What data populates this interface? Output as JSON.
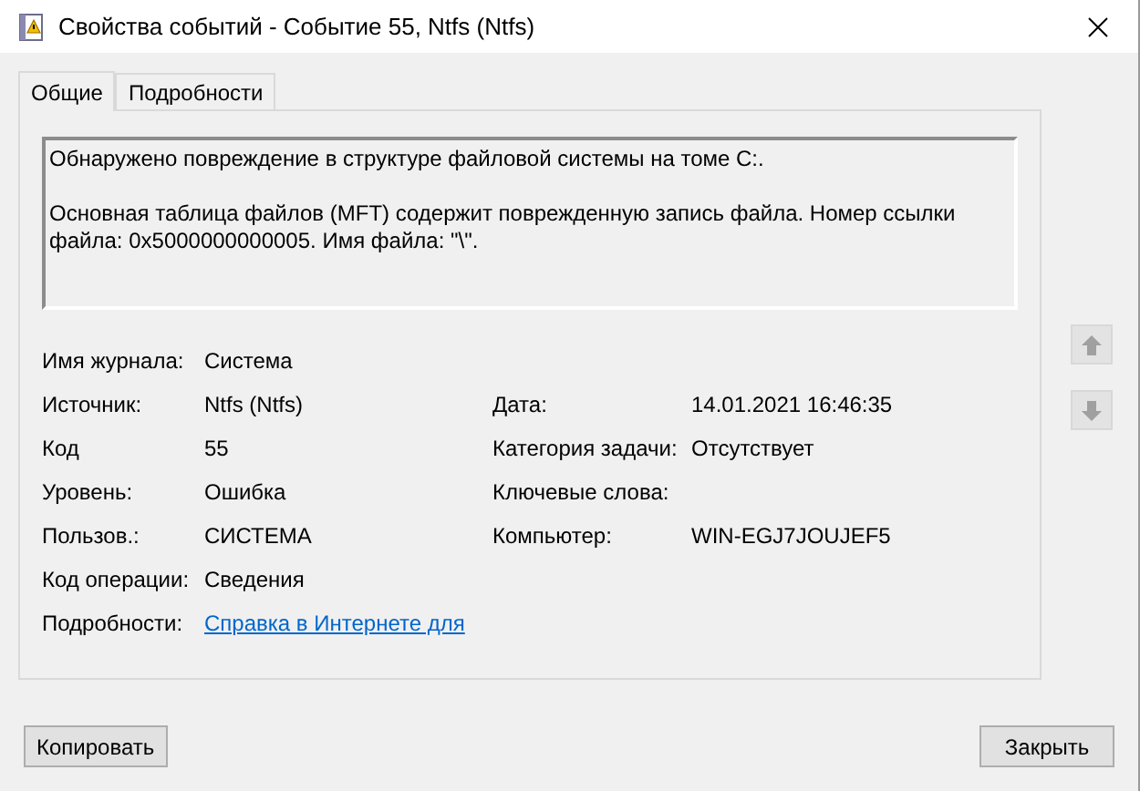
{
  "window": {
    "title": "Свойства событий - Событие 55, Ntfs (Ntfs)"
  },
  "tabs": [
    {
      "label": "Общие",
      "selected": true
    },
    {
      "label": "Подробности",
      "selected": false
    }
  ],
  "message": [
    "Обнаружено повреждение в структуре файловой системы на томе C:.",
    "Основная таблица файлов (MFT) содержит поврежденную запись файла.  Номер ссылки файла: 0x5000000000005.  Имя файла: \"\\\"."
  ],
  "fields_left": [
    {
      "label": "Имя журнала:",
      "value": "Система"
    },
    {
      "label": "Источник:",
      "value": "Ntfs (Ntfs)"
    },
    {
      "label": "Код",
      "value": "55"
    },
    {
      "label": "Уровень:",
      "value": "Ошибка"
    },
    {
      "label": "Пользов.:",
      "value": "СИСТЕМА"
    },
    {
      "label": "Код операции:",
      "value": "Сведения"
    },
    {
      "label": "Подробности:",
      "value": "Справка в Интернете для ",
      "kind": "link"
    }
  ],
  "fields_right": [
    {
      "label": "Дата:",
      "value": "14.01.2021 16:46:35"
    },
    {
      "label": "Категория задачи:",
      "value": "Отсутствует"
    },
    {
      "label": "Ключевые слова:"
    },
    {
      "label": "Компьютер:",
      "value": "WIN-EGJ7JOUJEF5"
    }
  ],
  "nav_buttons": [
    {
      "kind": "up",
      "disabled": true
    },
    {
      "kind": "down",
      "disabled": true
    }
  ],
  "buttons": [
    "Копировать",
    "Закрыть"
  ]
}
